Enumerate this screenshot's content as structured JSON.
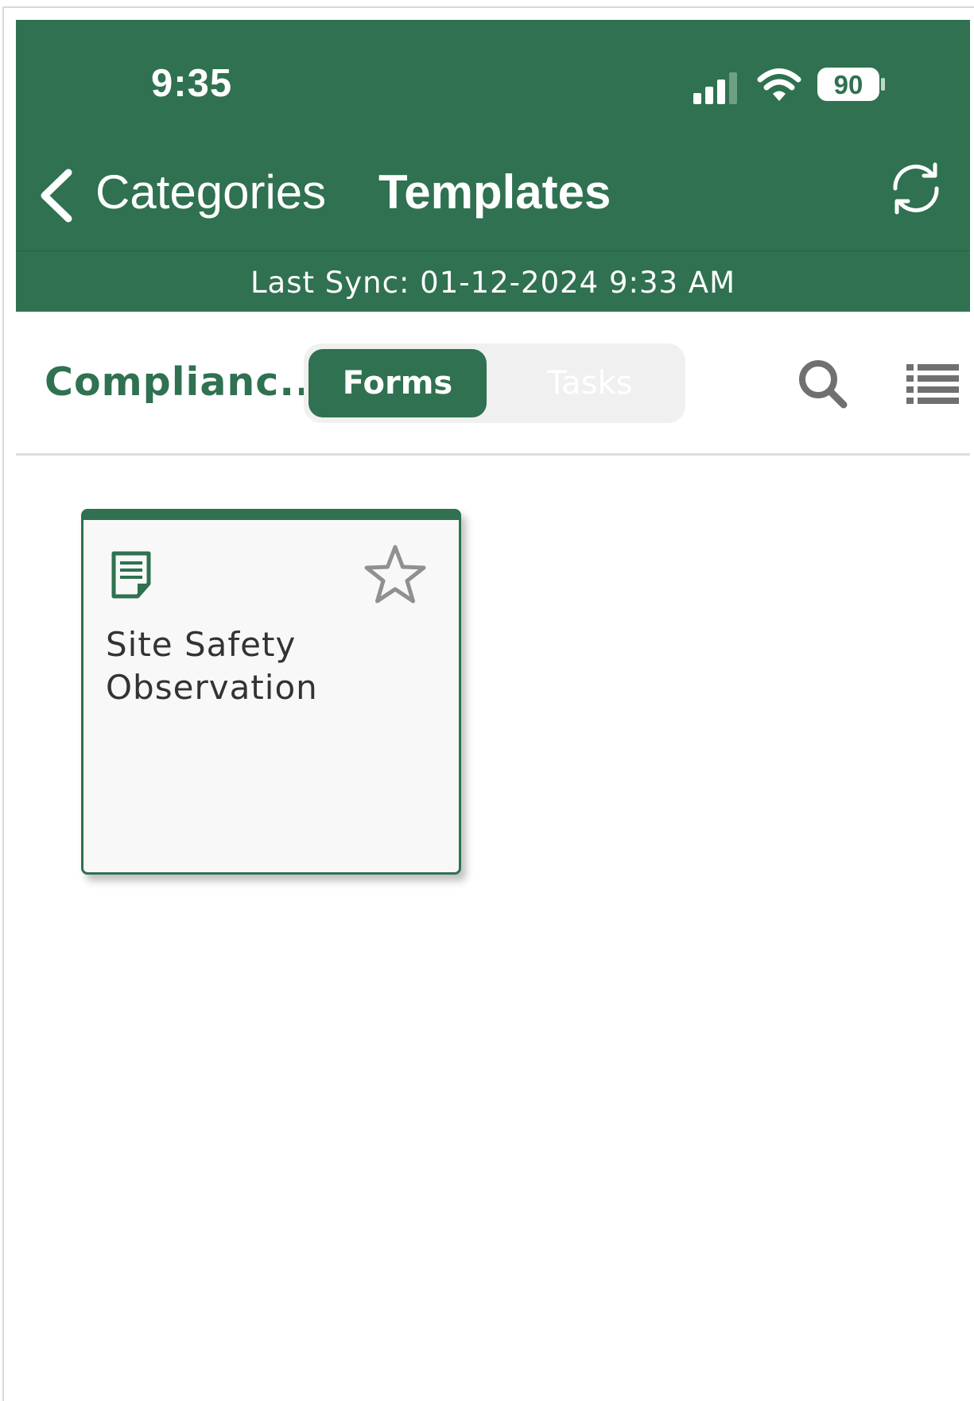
{
  "status_bar": {
    "time": "9:35",
    "battery_level": "90",
    "icons": [
      "signal-icon",
      "wifi-icon",
      "battery-icon"
    ]
  },
  "nav": {
    "back_label": "Categories",
    "title": "Templates",
    "refresh_icon": "refresh-icon"
  },
  "sync": {
    "text": "Last Sync: 01-12-2024 9:33 AM"
  },
  "toolbar": {
    "category": "Complianc...",
    "segments": [
      "Forms",
      "Tasks"
    ],
    "selected_segment": "Forms",
    "search_icon": "search-icon",
    "view_toggle_icon": "list-view-icon"
  },
  "templates": [
    {
      "title": "Site Safety Observation",
      "icon": "document-icon",
      "favorite_icon": "star-outline-icon",
      "favorited": false
    }
  ],
  "colors": {
    "brand_green": "#2f7150",
    "segment_bg": "#f0f0f0",
    "icon_gray": "#707070"
  }
}
